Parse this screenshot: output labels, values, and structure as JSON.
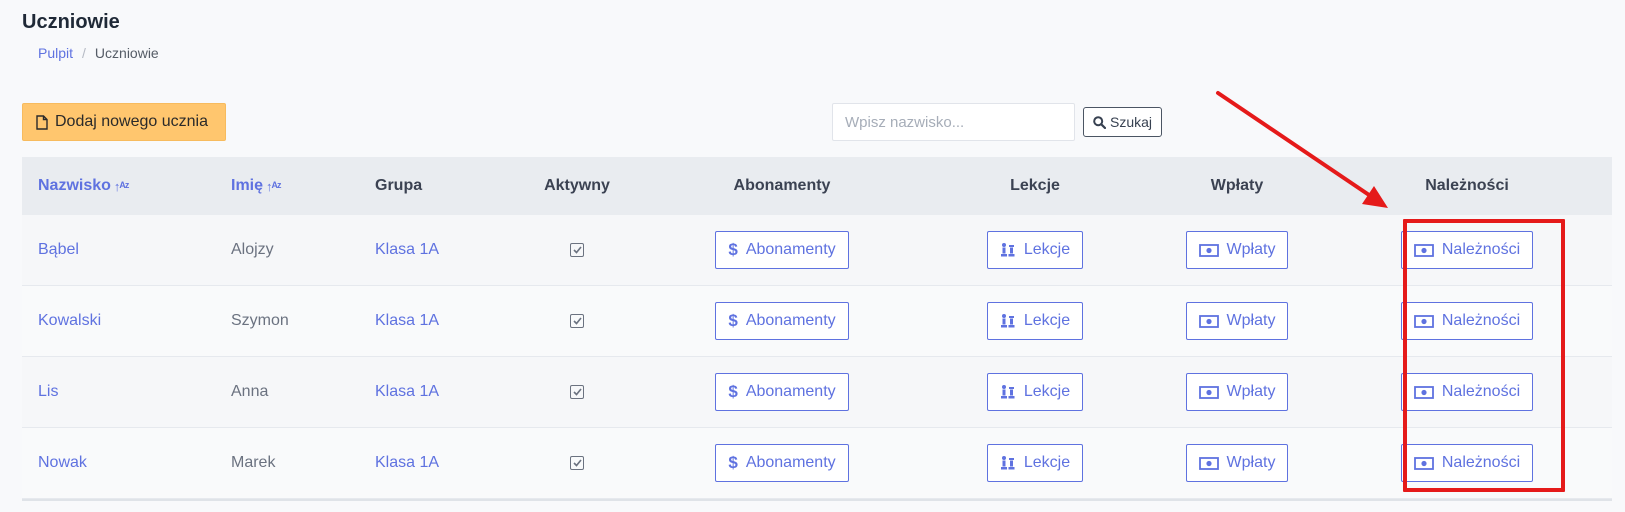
{
  "page": {
    "title": "Uczniowie",
    "breadcrumb": {
      "home": "Pulpit",
      "separator": "/",
      "current": "Uczniowie"
    }
  },
  "toolbar": {
    "add_label": "Dodaj nowego ucznia",
    "search_placeholder": "Wpisz nazwisko...",
    "search_value": "",
    "search_label": "Szukaj"
  },
  "table": {
    "columns": {
      "surname": "Nazwisko",
      "name": "Imię",
      "group": "Grupa",
      "active": "Aktywny",
      "subscriptions": "Abonamenty",
      "lessons": "Lekcje",
      "payments": "Wpłaty",
      "dues": "Należności"
    },
    "rows": [
      {
        "surname": "Bąbel",
        "name": "Alojzy",
        "group": "Klasa 1A",
        "active": true,
        "btn_subscriptions": "Abonamenty",
        "btn_lessons": "Lekcje",
        "btn_payments": "Wpłaty",
        "btn_dues": "Należności"
      },
      {
        "surname": "Kowalski",
        "name": "Szymon",
        "group": "Klasa 1A",
        "active": true,
        "btn_subscriptions": "Abonamenty",
        "btn_lessons": "Lekcje",
        "btn_payments": "Wpłaty",
        "btn_dues": "Należności"
      },
      {
        "surname": "Lis",
        "name": "Anna",
        "group": "Klasa 1A",
        "active": true,
        "btn_subscriptions": "Abonamenty",
        "btn_lessons": "Lekcje",
        "btn_payments": "Wpłaty",
        "btn_dues": "Należności"
      },
      {
        "surname": "Nowak",
        "name": "Marek",
        "group": "Klasa 1A",
        "active": true,
        "btn_subscriptions": "Abonamenty",
        "btn_lessons": "Lekcje",
        "btn_payments": "Wpłaty",
        "btn_dues": "Należności"
      }
    ]
  },
  "icons": {
    "add": "file-icon",
    "search": "search-icon",
    "sort": "sort-alpha-icon",
    "subscriptions": "dollar-icon",
    "lessons": "chess-icon",
    "payments": "money-bill-icon",
    "dues": "money-bill-icon",
    "active": "check-square-icon"
  },
  "colors": {
    "accent": "#5f72e0",
    "add_button": "#ffc66e",
    "highlight": "#e51a1a"
  }
}
